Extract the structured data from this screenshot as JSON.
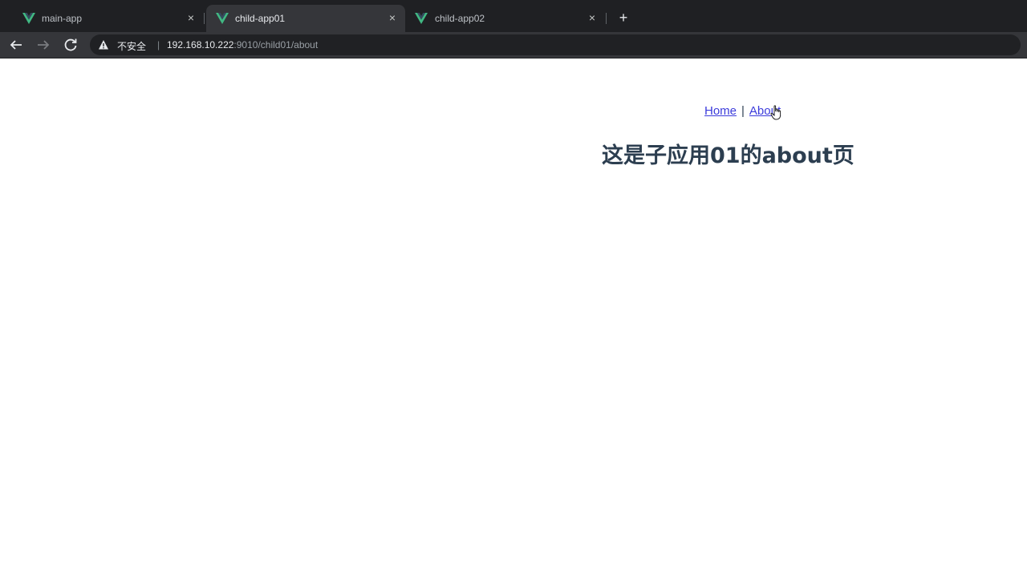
{
  "browser": {
    "tabs": [
      {
        "title": "main-app",
        "icon": "vue-icon",
        "active": false
      },
      {
        "title": "child-app01",
        "icon": "vue-icon",
        "active": true
      },
      {
        "title": "child-app02",
        "icon": "vue-icon",
        "active": false
      }
    ],
    "new_tab_label": "+",
    "close_label": "×",
    "address": {
      "security_label": "不安全",
      "divider": "|",
      "host": "192.168.10.222",
      "path": ":9010/child01/about"
    }
  },
  "page": {
    "nav": {
      "home_label": "Home",
      "separator": "|",
      "about_label": "About"
    },
    "heading": "这是子应用01的about页"
  },
  "colors": {
    "vue_green": "#41b883",
    "link": "#3b3bdb",
    "heading_text": "#2c3e50"
  }
}
